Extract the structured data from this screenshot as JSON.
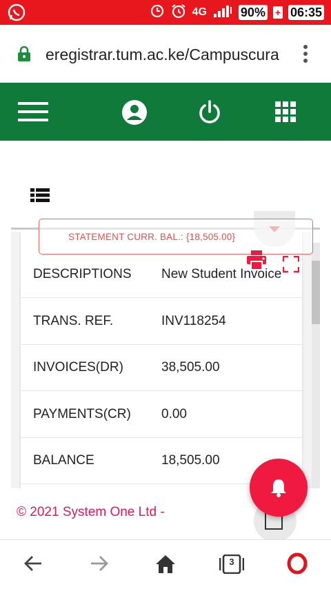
{
  "status_bar": {
    "battery": "90%",
    "time": "06:35",
    "network": "4G"
  },
  "browser": {
    "url": "eregistrar.tum.ac.ke/Campuscura",
    "tab_count": "3"
  },
  "colors": {
    "status_bar": "#e8161d",
    "header": "#0f7a39",
    "accent": "#f0193f",
    "footer_text": "#d81b60"
  },
  "header_icons": [
    "menu-icon",
    "account-icon",
    "power-icon",
    "apps-grid-icon"
  ],
  "statement": {
    "balance_label": "STATEMENT CURR. BAL.: {18,505.00}"
  },
  "rows": [
    {
      "label": "DESCRIPTIONS",
      "value": "New Student Invoice"
    },
    {
      "label": "TRANS. REF.",
      "value": "INV118254"
    },
    {
      "label": "INVOICES(DR)",
      "value": "38,505.00"
    },
    {
      "label": "PAYMENTS(CR)",
      "value": "0.00"
    },
    {
      "label": "BALANCE",
      "value": "18,505.00"
    }
  ],
  "footer": {
    "copyright": "© 2021 System One Ltd -"
  }
}
